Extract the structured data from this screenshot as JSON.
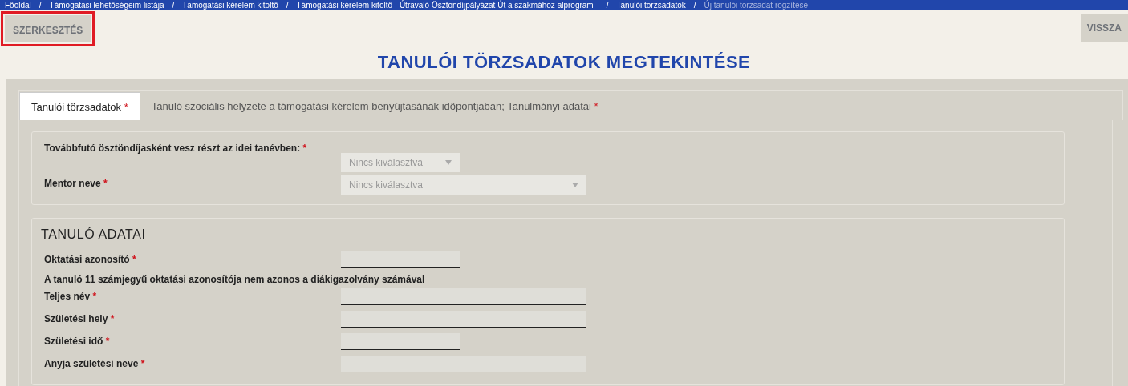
{
  "breadcrumb": {
    "separator": "/",
    "items": [
      {
        "label": "Főoldal",
        "current": false
      },
      {
        "label": "Támogatási lehetőségeim listája",
        "current": false
      },
      {
        "label": "Támogatási kérelem kitöltő",
        "current": false
      },
      {
        "label": "Támogatási kérelem kitöltő - Útravaló Ösztöndíjpályázat Út a szakmához alprogram -",
        "current": false
      },
      {
        "label": "Tanulói törzsadatok",
        "current": false
      },
      {
        "label": "Új tanulói törzsadat rögzítése",
        "current": true
      }
    ]
  },
  "toolbar": {
    "edit_button": {
      "label": "SZERKESZTÉS",
      "highlighted": true
    },
    "back_button": {
      "label": "VISSZA"
    }
  },
  "page_title": "TANULÓI TÖRZSADATOK MEGTEKINTÉSE",
  "tabs": [
    {
      "label": "Tanulói törzsadatok",
      "required": true,
      "selected": true
    },
    {
      "label": "Tanuló szociális helyzete a támogatási kérelem benyújtásának időpontjában; Tanulmányi adatai",
      "required": true,
      "selected": false
    }
  ],
  "required_mark": "*",
  "sections": [
    {
      "fields": [
        {
          "kind": "select",
          "label": "Továbbfutó ösztöndíjasként vesz részt az idei tanévben:",
          "required": true,
          "value": "Nincs kiválasztva"
        },
        {
          "kind": "wide_select",
          "label": "Mentor neve",
          "required": true,
          "value": "Nincs kiválasztva"
        }
      ]
    },
    {
      "title": "TANULÓ ADATAI",
      "fields": [
        {
          "kind": "input",
          "label": "Oktatási azonosító",
          "required": true
        },
        {
          "kind": "note",
          "label": "A tanuló 11 számjegyű oktatási azonosítója nem azonos a diákigazolvány számával",
          "required": false
        },
        {
          "kind": "wide_input",
          "label": "Teljes név",
          "required": true
        },
        {
          "kind": "wide_input",
          "label": "Születési hely",
          "required": true
        },
        {
          "kind": "input",
          "label": "Születési idő",
          "required": true
        },
        {
          "kind": "wide_input",
          "label": "Anyja születési neve",
          "required": true
        }
      ]
    }
  ]
}
